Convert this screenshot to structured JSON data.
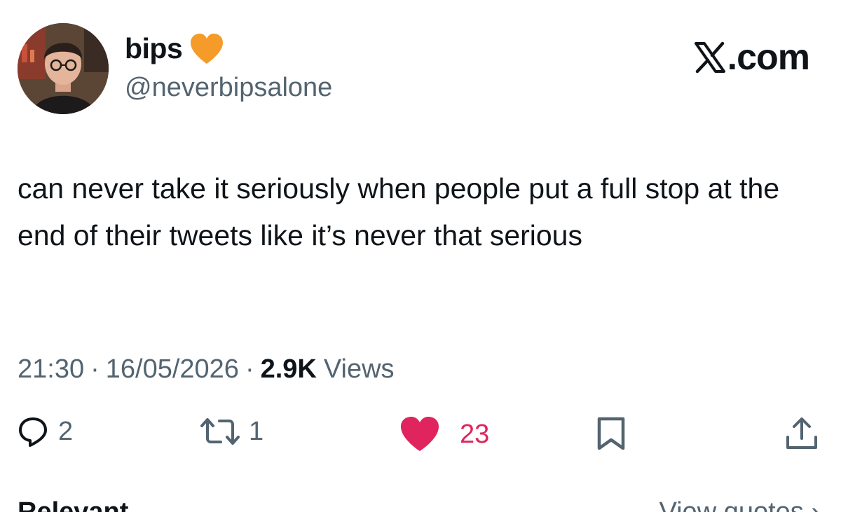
{
  "author": {
    "display_name": "bips",
    "handle": "@neverbipsalone",
    "badge_color": "#F59B2A"
  },
  "brand": {
    "label": ".com",
    "mark_icon": "x-logo-icon"
  },
  "tweet": {
    "text": "can never take it seriously when people put a full stop at the end of their tweets like it’s never that serious"
  },
  "meta": {
    "time": "21:30",
    "separator": "·",
    "date": "16/05/2026",
    "views_count": "2.9K",
    "views_label": "Views"
  },
  "actions": {
    "replies": "2",
    "retweets": "1",
    "likes": "23",
    "like_color": "#E0245E"
  },
  "footer": {
    "left_label": "Relevant",
    "right_label": "View quotes ›"
  }
}
